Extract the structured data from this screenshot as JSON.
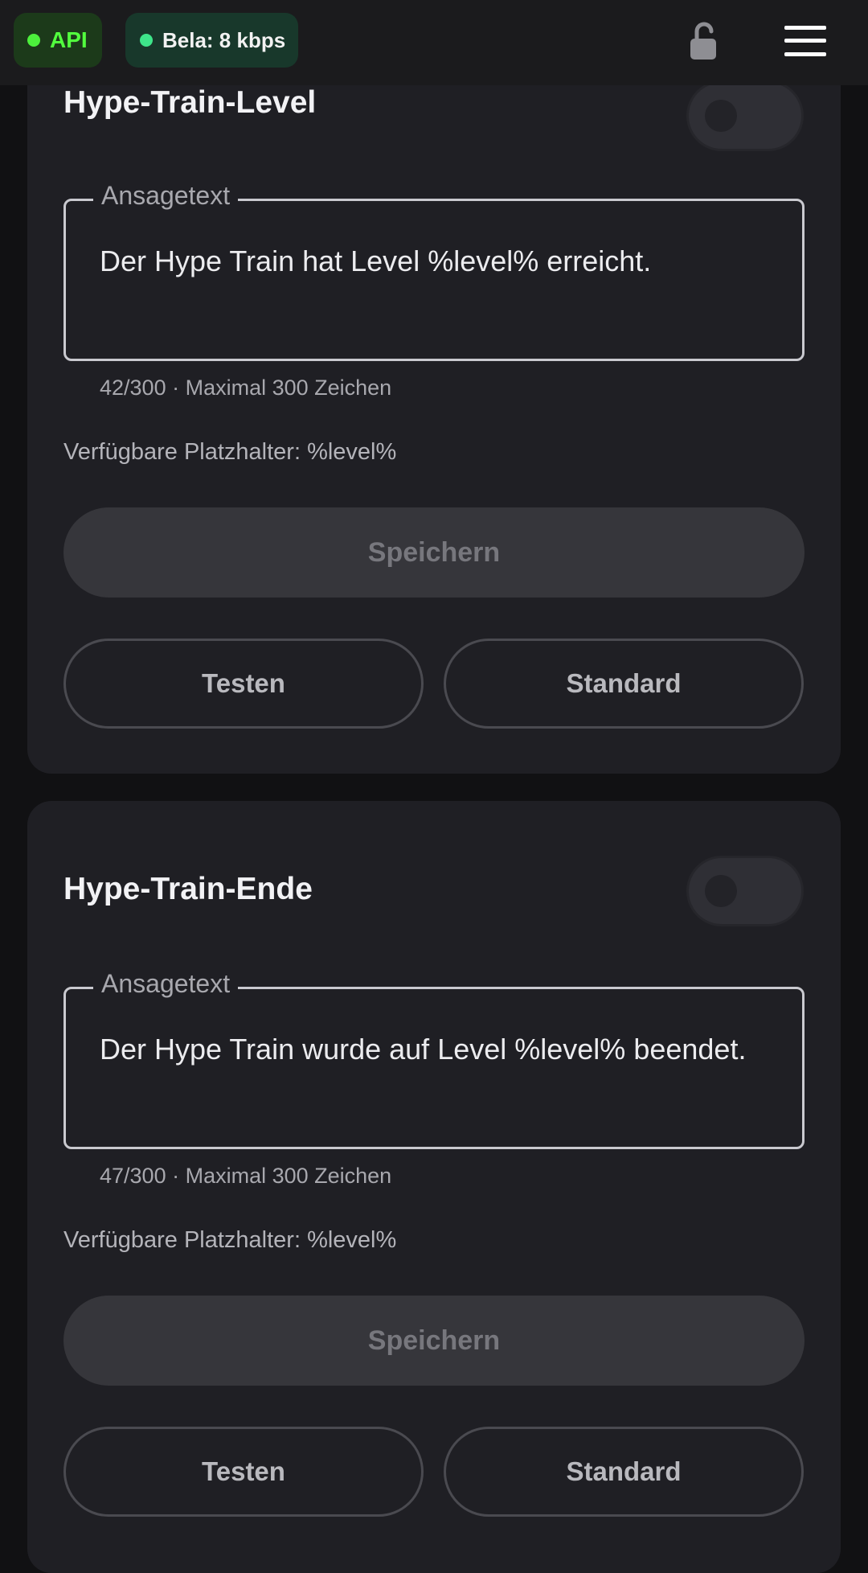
{
  "header": {
    "api_label": "API",
    "bitrate_label": "Bela: 8 kbps",
    "colors": {
      "api_dot": "#4cf03c",
      "bitrate_dot": "#3ee58a"
    },
    "icons": [
      "lock-open-icon",
      "hamburger-menu-icon"
    ]
  },
  "cards": [
    {
      "title": "Hype-Train-Level",
      "toggle_on": false,
      "field_label": "Ansagetext",
      "field_value": "Der Hype Train hat Level %level% erreicht.",
      "counter": "42/300 · Maximal 300 Zeichen",
      "placeholders": "Verfügbare Platzhalter: %level%",
      "save_label": "Speichern",
      "test_label": "Testen",
      "default_label": "Standard"
    },
    {
      "title": "Hype-Train-Ende",
      "toggle_on": false,
      "field_label": "Ansagetext",
      "field_value": "Der Hype Train wurde auf Level %level% beendet.",
      "counter": "47/300 · Maximal 300 Zeichen",
      "placeholders": "Verfügbare Platzhalter: %level%",
      "save_label": "Speichern",
      "test_label": "Testen",
      "default_label": "Standard"
    }
  ]
}
